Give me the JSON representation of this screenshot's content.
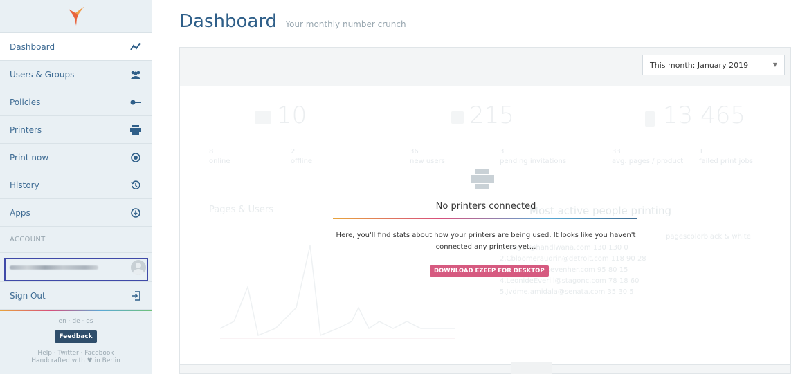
{
  "sidebar": {
    "items": [
      {
        "label": "Dashboard",
        "icon": "activity-icon"
      },
      {
        "label": "Users & Groups",
        "icon": "users-icon"
      },
      {
        "label": "Policies",
        "icon": "key-icon"
      },
      {
        "label": "Printers",
        "icon": "printer-icon"
      },
      {
        "label": "Print now",
        "icon": "target-icon"
      },
      {
        "label": "History",
        "icon": "history-icon"
      },
      {
        "label": "Apps",
        "icon": "download-icon"
      }
    ],
    "account_label": "ACCOUNT",
    "sign_out_label": "Sign Out",
    "languages": "en · de · es",
    "feedback_label": "Feedback",
    "footer_links": "Help · Twitter · Facebook",
    "footer_credit": "Handcrafted with ♥ in Berlin"
  },
  "header": {
    "title": "Dashboard",
    "subtitle": "Your monthly number crunch"
  },
  "filter": {
    "selected": "This month: January 2019"
  },
  "faded_stats": {
    "big": [
      "10",
      "215",
      "13 465"
    ],
    "small": [
      {
        "value": "8",
        "label": "online"
      },
      {
        "value": "2",
        "label": "offline"
      },
      {
        "value": "36",
        "label": "new users"
      },
      {
        "value": "3",
        "label": "pending invitations"
      },
      {
        "value": "33",
        "label": "avg. pages / product"
      },
      {
        "value": "1",
        "label": "failed print jobs"
      }
    ],
    "pages_users": "Pages & Users",
    "active_people": "Most active people printing",
    "list_header": "pagescolorblack & white",
    "list": [
      "1.Rmyer@handlwana.com  130  130  0",
      "2.Cbloomeraudrin@detroit.com 118  90  28",
      "3.Glombers@sevenher.com  95  80  15",
      "4.LeonideEverill@stagonc.com 78  18  60",
      "5.Jvdme.amidala@senata.com 35  30  5"
    ]
  },
  "empty_state": {
    "title": "No printers connected",
    "text": "Here, you'll find stats about how your printers are being used. It looks like you haven't connected any printers yet...",
    "button": "DOWNLOAD EZEEP FOR DESKTOP"
  },
  "colors": {
    "accent": "#3f6c94",
    "button_pink": "#d65a80",
    "feedback_bg": "#2f4e6b"
  }
}
